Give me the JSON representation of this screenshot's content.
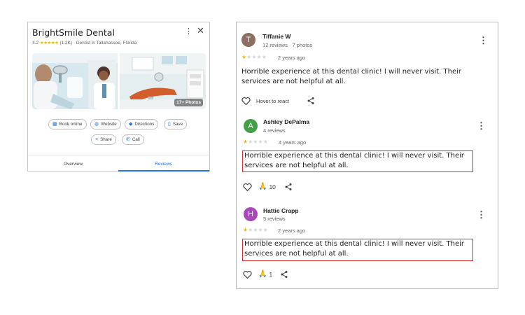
{
  "business": {
    "name": "BrightSmile Dental",
    "rating": "4.2",
    "stars": "★★★★★",
    "count": "(1.2K)",
    "separator": "·",
    "category": "Dentist in Tallahassee, Florida",
    "photos_badge": "17+ Photos",
    "actions": {
      "book": "Book online",
      "website": "Website",
      "directions": "Directions",
      "save": "Save",
      "share": "Share",
      "call": "Call"
    },
    "tabs": {
      "overview": "Overview",
      "reviews": "Reviews"
    }
  },
  "reviews": [
    {
      "initial": "T",
      "avatar_color": "#8d6e63",
      "name": "Tiffanie W",
      "meta": "12 reviews · 7 photos",
      "stars_on": "★",
      "stars_off": "★★★★",
      "age": "2 years ago",
      "text": "Horrible experience at this dental clinic! I will never visit. Their services are not helpful at all.",
      "react_label": "Hover to react"
    },
    {
      "initial": "A",
      "avatar_color": "#43a047",
      "name": "Ashley DePalma",
      "meta": "4 reviews",
      "stars_on": "★",
      "stars_off": "★★★★",
      "age": "4 years ago",
      "text": "Horrible experience at this dental clinic! I will never visit. Their services are not helpful at all.",
      "reaction_count": "10"
    },
    {
      "initial": "H",
      "avatar_color": "#ab47bc",
      "name": "Hattie Crapp",
      "meta": "5 reviews",
      "stars_on": "★",
      "stars_off": "★★★★",
      "age": "2 years ago",
      "text": "Horrible experience at this dental clinic! I will never visit. Their services are not helpful at all.",
      "reaction_count": "1"
    }
  ]
}
